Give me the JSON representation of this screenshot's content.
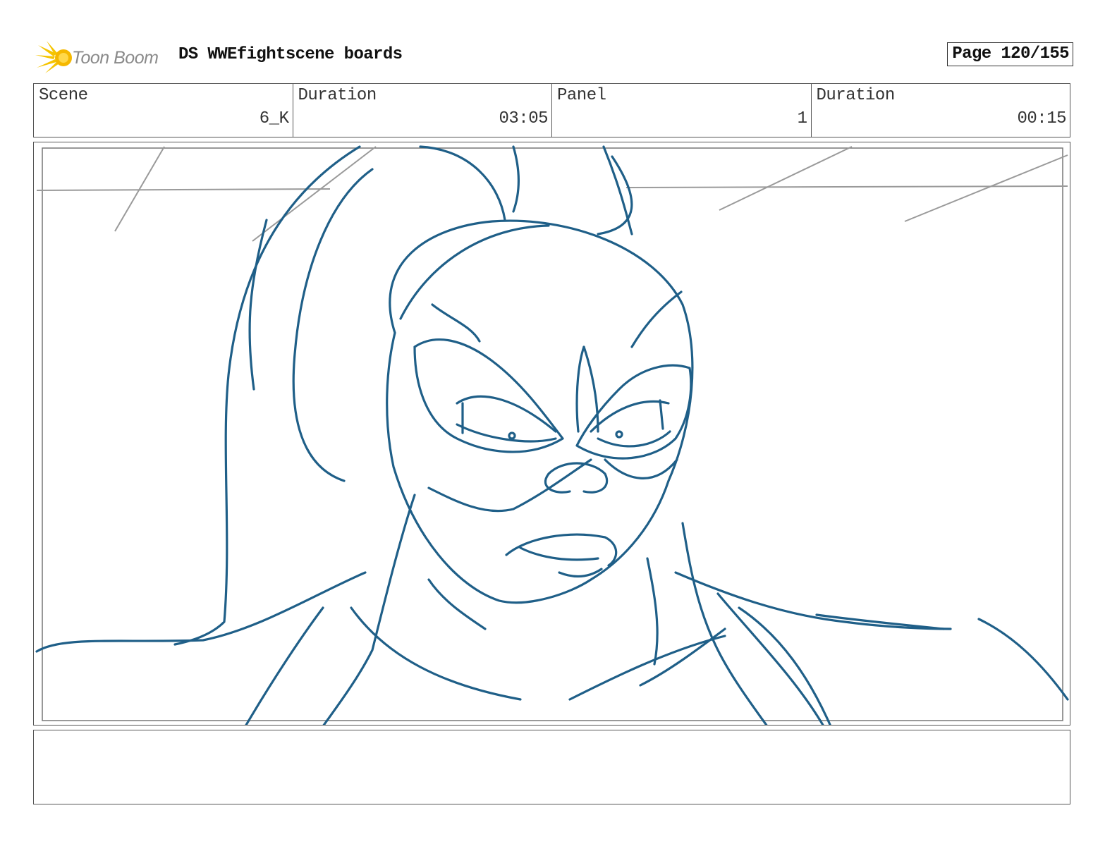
{
  "header": {
    "logo_text": "Toon Boom",
    "title": "DS WWEfightscene boards",
    "page_label": "Page 120/155"
  },
  "info": [
    {
      "label": "Scene",
      "value": "6_K"
    },
    {
      "label": "Duration",
      "value": "03:05"
    },
    {
      "label": "Panel",
      "value": "1"
    },
    {
      "label": "Duration",
      "value": "00:15"
    }
  ],
  "panel": {
    "drawing": "sketch-of-masked-wrestler-face",
    "stroke_color": "#1f5f88",
    "guide_color": "#999999"
  },
  "notes": {
    "text": ""
  },
  "colors": {
    "logo_burst": "#f5c400",
    "logo_text": "#8a8a8a",
    "border": "#555555"
  }
}
